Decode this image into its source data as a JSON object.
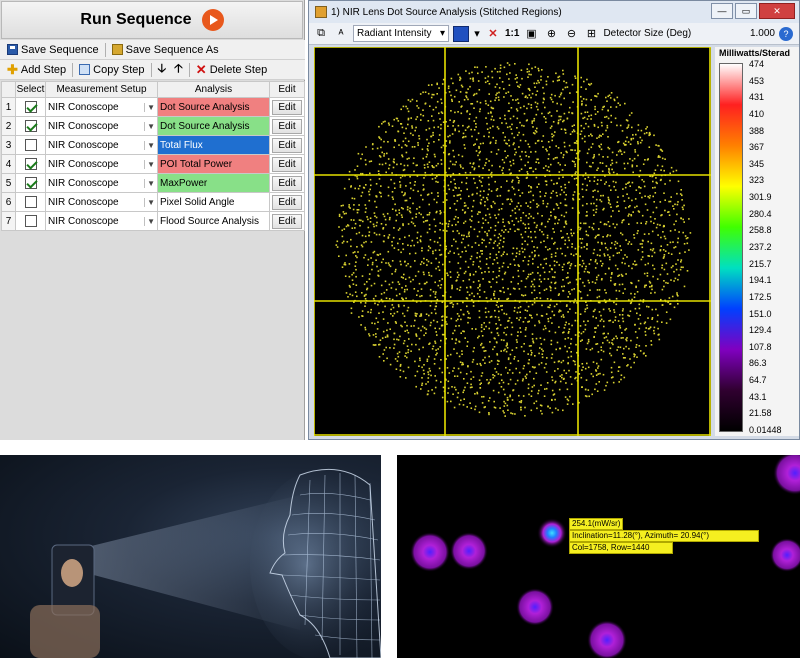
{
  "sequence": {
    "run_label": "Run Sequence",
    "save_label": "Save Sequence",
    "save_as_label": "Save Sequence As",
    "add_step_label": "Add Step",
    "copy_step_label": "Copy Step",
    "delete_step_label": "Delete Step",
    "down_glyph": "🡣",
    "up_glyph": "🡡",
    "headers": {
      "select": "Select",
      "setup": "Measurement Setup",
      "analysis": "Analysis",
      "edit": "Edit"
    },
    "edit_label": "Edit",
    "rows": [
      {
        "num": "1",
        "checked": true,
        "setup": "NIR Conoscope",
        "analysis": "Dot Source Analysis",
        "status": "red"
      },
      {
        "num": "2",
        "checked": true,
        "setup": "NIR Conoscope",
        "analysis": "Dot Source Analysis",
        "status": "green"
      },
      {
        "num": "3",
        "checked": false,
        "setup": "NIR Conoscope",
        "analysis": "Total Flux",
        "status": "blue"
      },
      {
        "num": "4",
        "checked": true,
        "setup": "NIR Conoscope",
        "analysis": "POI Total Power",
        "status": "red"
      },
      {
        "num": "5",
        "checked": true,
        "setup": "NIR Conoscope",
        "analysis": "MaxPower",
        "status": "green"
      },
      {
        "num": "6",
        "checked": false,
        "setup": "NIR Conoscope",
        "analysis": "Pixel Solid Angle",
        "status": "white"
      },
      {
        "num": "7",
        "checked": false,
        "setup": "NIR Conoscope",
        "analysis": "Flood Source Analysis",
        "status": "white"
      }
    ],
    "status_colors": {
      "red": "#f08080",
      "green": "#88e088",
      "blue": "#1f6fd0",
      "white": "#ffffff"
    }
  },
  "analysis_window": {
    "title": "1) NIR Lens Dot Source Analysis  (Stitched Regions)",
    "min_glyph": "—",
    "max_glyph": "▭",
    "close_glyph": "✕",
    "display_mode": "Radiant Intensity",
    "zoom_label": "1:1",
    "detector_label": "Detector Size (Deg)",
    "detector_value": "1.000",
    "help_glyph": "?",
    "grid_color": "#e6e000",
    "dot_color": "#d8d030"
  },
  "colorbar": {
    "title": "Milliwatts/Sterad",
    "ticks": [
      "474",
      "453",
      "431",
      "410",
      "388",
      "367",
      "345",
      "323",
      "301.9",
      "280.4",
      "258.8",
      "237.2",
      "215.7",
      "194.1",
      "172.5",
      "151.0",
      "129.4",
      "107.8",
      "86.3",
      "64.7",
      "43.1",
      "21.58",
      "0.01448"
    ],
    "gradient": [
      "#ffffff",
      "#ff2020",
      "#ff8000",
      "#ffff00",
      "#40ff00",
      "#00e0c0",
      "#0040ff",
      "#8000c0",
      "#300030",
      "#000000"
    ]
  },
  "dot_zoom": {
    "label_value": "254.1(mW/sr)",
    "label_angles": "Inclination=11.28(°), Azimuth= 20.94(°)",
    "label_pixel": "Col=1758, Row=1440",
    "blob_color": "#c020d0"
  }
}
